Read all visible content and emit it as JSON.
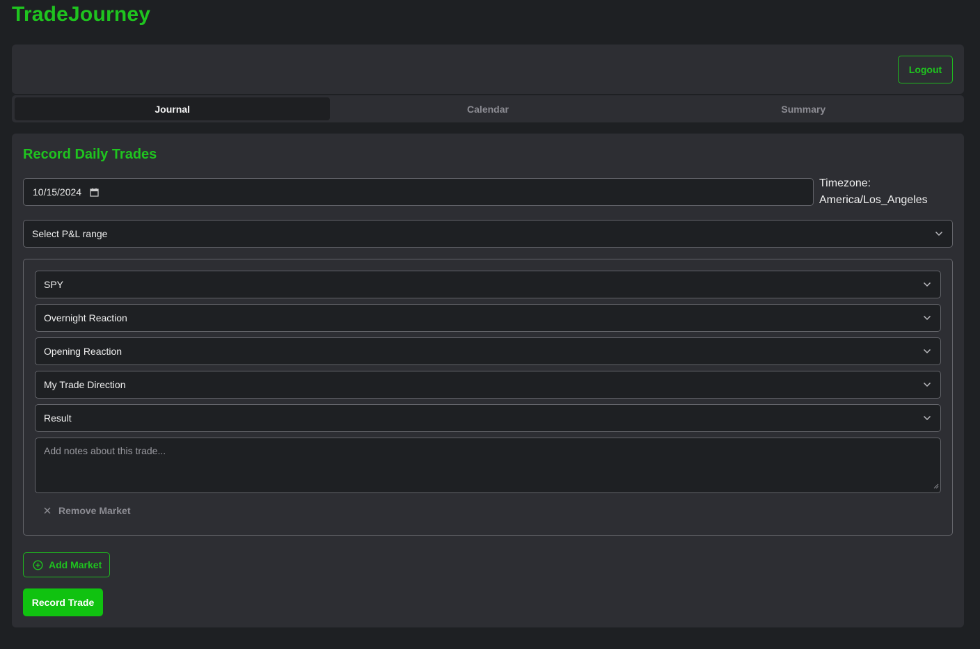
{
  "app": {
    "title": "TradeJourney"
  },
  "header": {
    "logout_label": "Logout"
  },
  "tabs": [
    {
      "label": "Journal",
      "active": true
    },
    {
      "label": "Calendar",
      "active": false
    },
    {
      "label": "Summary",
      "active": false
    }
  ],
  "form": {
    "title": "Record Daily Trades",
    "date_value": "10/15/2024",
    "timezone_label": "Timezone:",
    "timezone_value": "America/Los_Angeles",
    "pl_range_placeholder": "Select P&L range",
    "market": {
      "symbol": "SPY",
      "overnight_reaction": "Overnight Reaction",
      "opening_reaction": "Opening Reaction",
      "trade_direction": "My Trade Direction",
      "result": "Result",
      "notes_placeholder": "Add notes about this trade...",
      "remove_label": "Remove Market"
    },
    "add_market_label": "Add Market",
    "record_label": "Record Trade"
  },
  "colors": {
    "accent": "#1fc41f",
    "background": "#1e2023",
    "card": "#2d2e33",
    "border": "#64656b",
    "primary_button": "#10c210"
  },
  "icons": [
    "calendar-icon",
    "chevron-down-icon",
    "close-icon",
    "plus-circle-icon",
    "resize-grip-icon"
  ]
}
